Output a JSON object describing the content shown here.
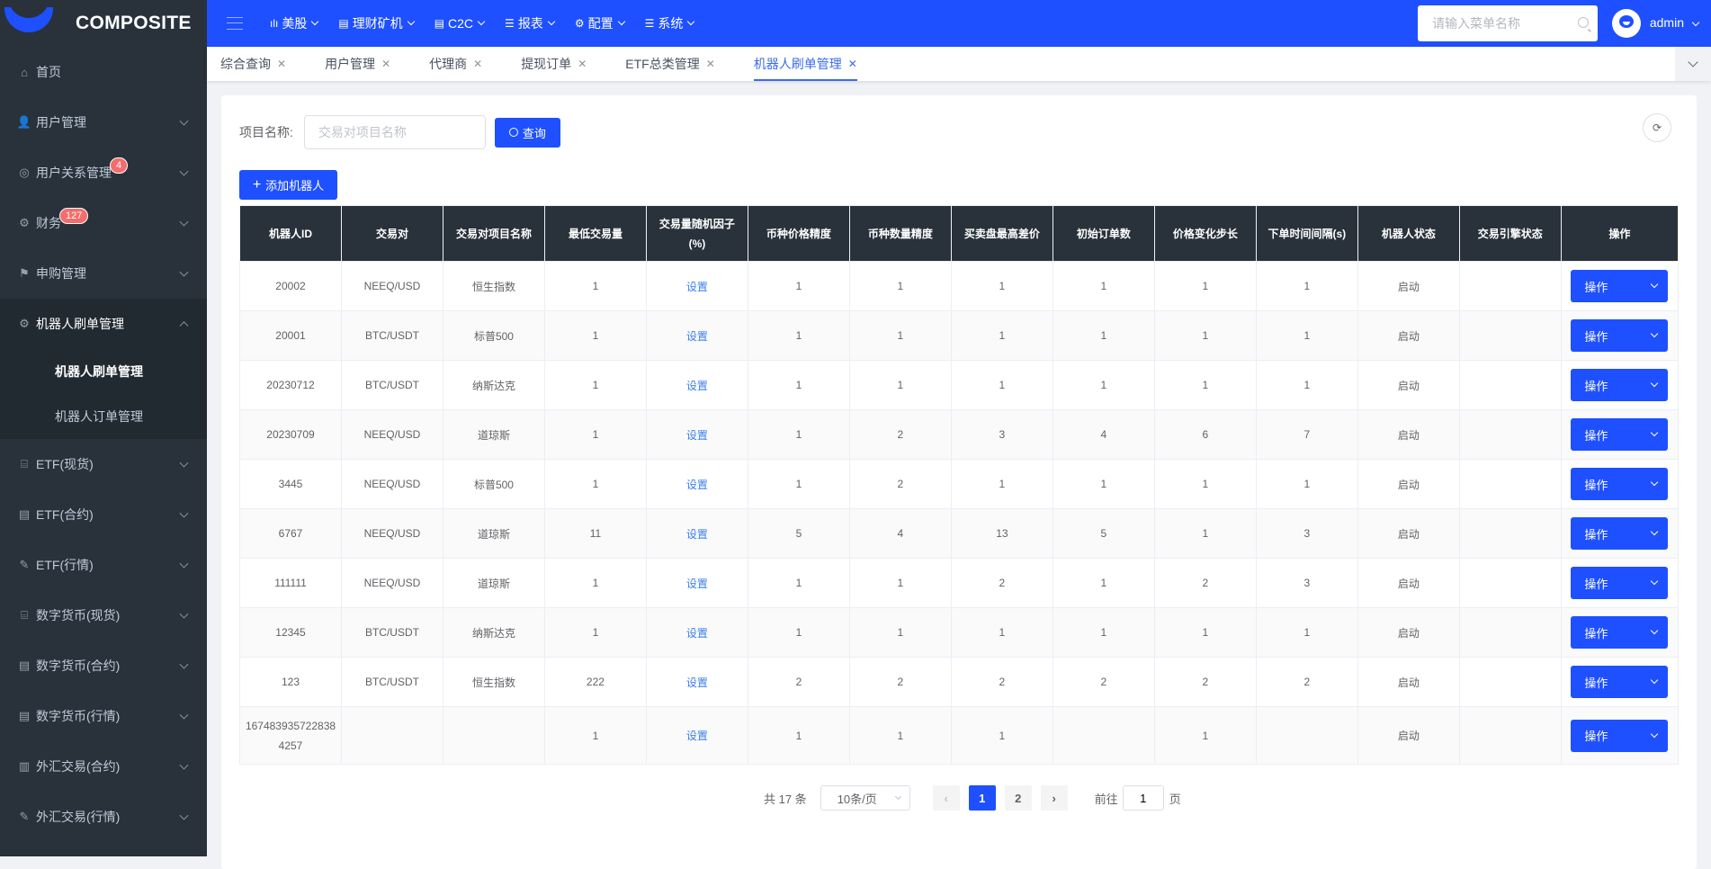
{
  "app": {
    "logo_text": "COMPOSITE"
  },
  "sidebar": {
    "items": [
      {
        "label": "首页",
        "icon": "home-icon",
        "glyph": "⌂",
        "badge": null,
        "chevron": false
      },
      {
        "label": "用户管理",
        "icon": "user-icon",
        "glyph": "👤",
        "badge": null,
        "chevron": true
      },
      {
        "label": "用户关系管理",
        "icon": "user-circle-icon",
        "glyph": "◎",
        "badge": "4",
        "chevron": true
      },
      {
        "label": "财务",
        "icon": "gear-icon",
        "glyph": "⚙",
        "badge": "127",
        "chevron": true
      },
      {
        "label": "申购管理",
        "icon": "signpost-icon",
        "glyph": "⚑",
        "badge": null,
        "chevron": true
      },
      {
        "label": "机器人刷单管理",
        "icon": "settings-icon",
        "glyph": "⚙",
        "badge": null,
        "chevron": true,
        "open": true,
        "children": [
          {
            "label": "机器人刷单管理",
            "active": true
          },
          {
            "label": "机器人订单管理",
            "active": false
          }
        ]
      },
      {
        "label": "ETF(现货)",
        "icon": "shop-icon",
        "glyph": "⌸",
        "badge": null,
        "chevron": true
      },
      {
        "label": "ETF(合约)",
        "icon": "sql-file-icon",
        "glyph": "▤",
        "badge": null,
        "chevron": true
      },
      {
        "label": "ETF(行情)",
        "icon": "edit-icon",
        "glyph": "✎",
        "badge": null,
        "chevron": true
      },
      {
        "label": "数字货币(现货)",
        "icon": "shop-icon",
        "glyph": "⌸",
        "badge": null,
        "chevron": true
      },
      {
        "label": "数字货币(合约)",
        "icon": "sql-file-icon",
        "glyph": "▤",
        "badge": null,
        "chevron": true
      },
      {
        "label": "数字货币(行情)",
        "icon": "sql-file-icon",
        "glyph": "▤",
        "badge": null,
        "chevron": true
      },
      {
        "label": "外汇交易(合约)",
        "icon": "document-icon",
        "glyph": "▥",
        "badge": null,
        "chevron": true
      },
      {
        "label": "外汇交易(行情)",
        "icon": "edit-icon",
        "glyph": "✎",
        "badge": null,
        "chevron": true
      }
    ]
  },
  "topnav": {
    "items": [
      {
        "label": "美股",
        "icon": "bar-chart-icon",
        "glyph": "ılı"
      },
      {
        "label": "理财矿机",
        "icon": "list-box-icon",
        "glyph": "▤"
      },
      {
        "label": "C2C",
        "icon": "list-box-icon",
        "glyph": "▤"
      },
      {
        "label": "报表",
        "icon": "list-icon",
        "glyph": "☰"
      },
      {
        "label": "配置",
        "icon": "gear-icon",
        "glyph": "⚙"
      },
      {
        "label": "系统",
        "icon": "list-icon",
        "glyph": "☰"
      }
    ],
    "search_placeholder": "请输入菜单名称",
    "username": "admin"
  },
  "tabs": [
    {
      "label": "综合查询",
      "active": false
    },
    {
      "label": "用户管理",
      "active": false
    },
    {
      "label": "代理商",
      "active": false
    },
    {
      "label": "提现订单",
      "active": false
    },
    {
      "label": "ETF总类管理",
      "active": false
    },
    {
      "label": "机器人刷单管理",
      "active": true
    }
  ],
  "filter": {
    "label": "项目名称:",
    "placeholder": "交易对项目名称",
    "value": "",
    "query_label": "查询",
    "add_label": "添加机器人"
  },
  "table": {
    "columns": [
      "机器人ID",
      "交易对",
      "交易对项目名称",
      "最低交易量",
      "交易量随机因子(%)",
      "币种价格精度",
      "币种数量精度",
      "买卖盘最高差价",
      "初始订单数",
      "价格变化步长",
      "下单时间间隔(s)",
      "机器人状态",
      "交易引擎状态",
      "操作"
    ],
    "set_label": "设置",
    "op_label": "操作",
    "rows": [
      [
        "20002",
        "NEEQ/USD",
        "恒生指数",
        "1",
        "1",
        "1",
        "1",
        "1",
        "1",
        "1",
        "启动",
        ""
      ],
      [
        "20001",
        "BTC/USDT",
        "标普500",
        "1",
        "1",
        "1",
        "1",
        "1",
        "1",
        "1",
        "启动",
        ""
      ],
      [
        "20230712",
        "BTC/USDT",
        "纳斯达克",
        "1",
        "1",
        "1",
        "1",
        "1",
        "1",
        "1",
        "启动",
        ""
      ],
      [
        "20230709",
        "NEEQ/USD",
        "道琼斯",
        "1",
        "1",
        "2",
        "3",
        "4",
        "6",
        "7",
        "启动",
        ""
      ],
      [
        "3445",
        "NEEQ/USD",
        "标普500",
        "1",
        "1",
        "2",
        "1",
        "1",
        "1",
        "1",
        "启动",
        ""
      ],
      [
        "6767",
        "NEEQ/USD",
        "道琼斯",
        "11",
        "5",
        "4",
        "13",
        "5",
        "1",
        "3",
        "启动",
        ""
      ],
      [
        "111111",
        "NEEQ/USD",
        "道琼斯",
        "1",
        "1",
        "1",
        "2",
        "1",
        "2",
        "3",
        "启动",
        ""
      ],
      [
        "12345",
        "BTC/USDT",
        "纳斯达克",
        "1",
        "1",
        "1",
        "1",
        "1",
        "1",
        "1",
        "启动",
        ""
      ],
      [
        "123",
        "BTC/USDT",
        "恒生指数",
        "222",
        "2",
        "2",
        "2",
        "2",
        "2",
        "2",
        "启动",
        ""
      ],
      [
        "1674839357228384257",
        "",
        "",
        "1",
        "1",
        "1",
        "1",
        "",
        "1",
        "",
        "启动",
        ""
      ]
    ]
  },
  "pagination": {
    "total_text": "共 17 条",
    "page_size": "10条/页",
    "pages": [
      "1",
      "2"
    ],
    "current": "1",
    "goto_label": "前往",
    "goto_value": "1",
    "page_suffix": "页"
  },
  "colors": {
    "primary": "#1e50ff",
    "sidebar_bg": "#29323b",
    "badge": "#f56c6c",
    "link": "#3a7ef0"
  }
}
